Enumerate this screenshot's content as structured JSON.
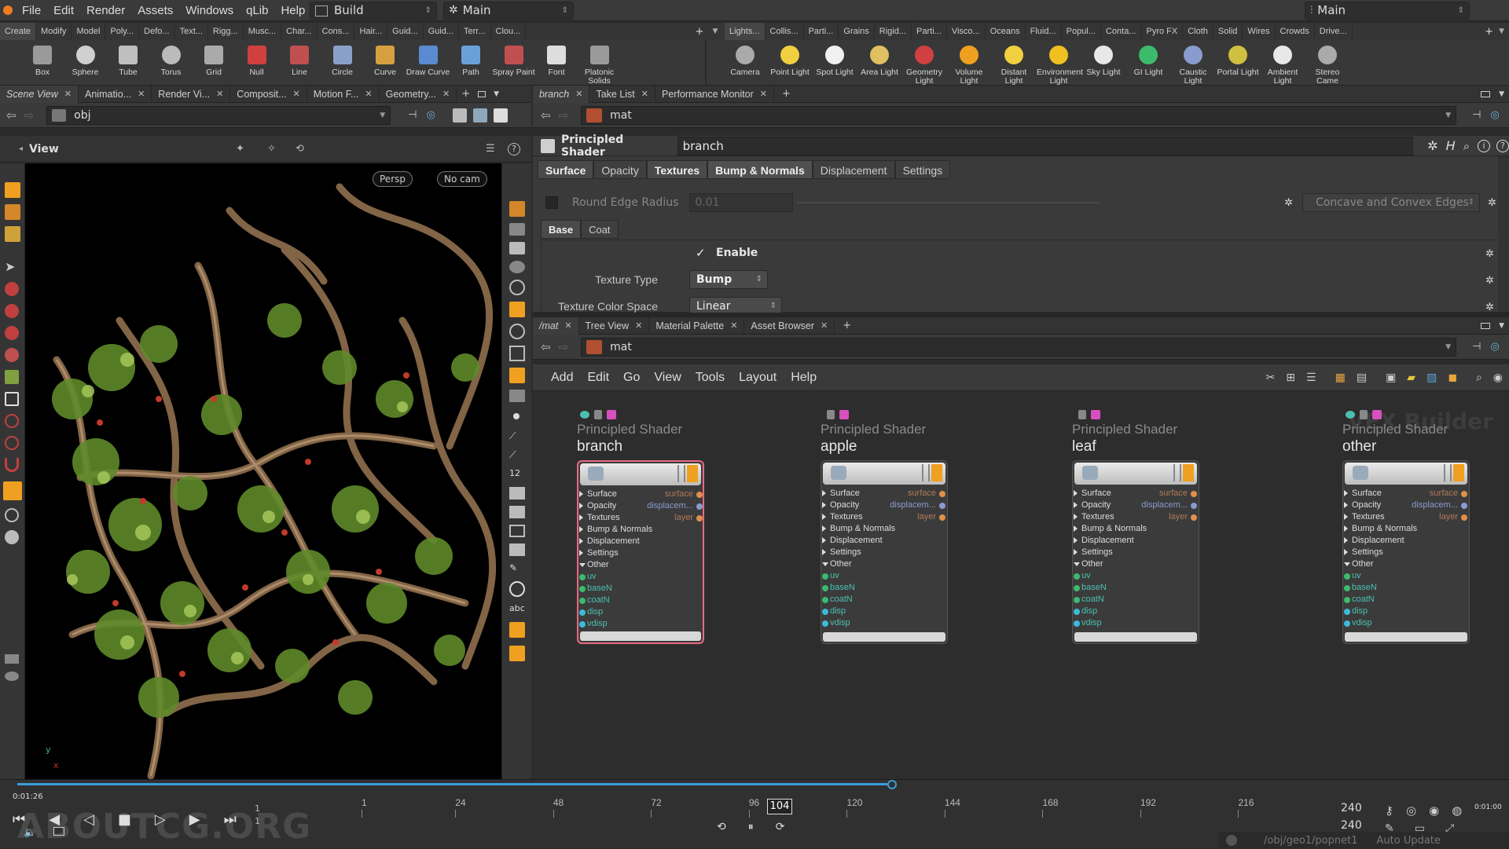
{
  "menubar": {
    "items": [
      "File",
      "Edit",
      "Render",
      "Assets",
      "Windows",
      "qLib",
      "Help"
    ],
    "desktop_left": "Build",
    "desktop_mid": "Main",
    "desktop_right": "Main"
  },
  "shelf": {
    "tabs_left": [
      "Create",
      "Modify",
      "Model",
      "Poly...",
      "Defo...",
      "Text...",
      "Rigg...",
      "Musc...",
      "Char...",
      "Cons...",
      "Hair...",
      "Guid...",
      "Guid...",
      "Terr...",
      "Clou..."
    ],
    "tabs_right": [
      "Lights...",
      "Collis...",
      "Parti...",
      "Grains",
      "Rigid...",
      "Parti...",
      "Visco...",
      "Oceans",
      "Fluid...",
      "Popul...",
      "Conta...",
      "Pyro FX",
      "Cloth",
      "Solid",
      "Wires",
      "Crowds",
      "Drive..."
    ],
    "tools_left": [
      "Box",
      "Sphere",
      "Tube",
      "Torus",
      "Grid",
      "Null",
      "Line",
      "Circle",
      "Curve",
      "Draw Curve",
      "Path",
      "Spray Paint",
      "Font",
      "Platonic Solids"
    ],
    "tools_right": [
      "Camera",
      "Point Light",
      "Spot Light",
      "Area Light",
      "Geometry Light",
      "Volume Light",
      "Distant Light",
      "Environment Light",
      "Sky Light",
      "GI Light",
      "Caustic Light",
      "Portal Light",
      "Ambient Light",
      "Stereo Came"
    ]
  },
  "left_pane": {
    "tabs": [
      "Scene View",
      "Animatio...",
      "Render Vi...",
      "Composit...",
      "Motion F...",
      "Geometry..."
    ],
    "path": "obj",
    "view_label": "View",
    "persp": "Persp",
    "nocam": "No cam",
    "axis_y": "y",
    "axis_x": "x"
  },
  "param_pane": {
    "tabs": [
      "branch",
      "Take List",
      "Performance Monitor"
    ],
    "path": "mat",
    "node_type": "Principled Shader",
    "node_name": "branch",
    "param_tabs": [
      "Surface",
      "Opacity",
      "Textures",
      "Bump & Normals",
      "Displacement",
      "Settings"
    ],
    "active_tab": "Bump & Normals",
    "round_edge_label": "Round Edge Radius",
    "round_edge_value": "0.01",
    "concave_label": "Concave and Convex Edges",
    "sub_tabs": [
      "Base",
      "Coat"
    ],
    "enable_label": "Enable",
    "texture_type_label": "Texture Type",
    "texture_type_value": "Bump",
    "texture_cs_label": "Texture Color Space",
    "texture_cs_value": "Linear"
  },
  "network_pane": {
    "tabs": [
      "/mat",
      "Tree View",
      "Material Palette",
      "Asset Browser"
    ],
    "path": "mat",
    "menu": [
      "Add",
      "Edit",
      "Go",
      "View",
      "Tools",
      "Layout",
      "Help"
    ],
    "watermark": "VEX Builder",
    "ports": [
      "Surface",
      "Opacity",
      "Textures",
      "Bump & Normals",
      "Displacement",
      "Settings",
      "Other"
    ],
    "outputs": [
      "surface",
      "displacem...",
      "layer"
    ],
    "inputs": [
      "uv",
      "baseN",
      "coatN",
      "disp",
      "vdisp"
    ],
    "nodes": [
      {
        "type": "Principled Shader",
        "name": "branch"
      },
      {
        "type": "Principled Shader",
        "name": "apple"
      },
      {
        "type": "Principled Shader",
        "name": "leaf"
      },
      {
        "type": "Principled Shader",
        "name": "other"
      }
    ]
  },
  "timeline": {
    "time": "0:01:26",
    "ticks": [
      "1",
      "24",
      "48",
      "72",
      "96",
      "120",
      "144",
      "168",
      "192",
      "216"
    ],
    "current_frame": "104",
    "end_a": "240",
    "end_b": "240",
    "left_start": "1",
    "left_frame": "1",
    "time_right": "0:01:00",
    "status_path": "/obj/geo1/popnet1",
    "auto_update": "Auto Update",
    "watermark": "ABOUTCG.ORG"
  },
  "colors": {
    "accent_orange": "#f0a020",
    "selected_node": "#e86a83",
    "timeline_blue": "#3a9bd8"
  }
}
